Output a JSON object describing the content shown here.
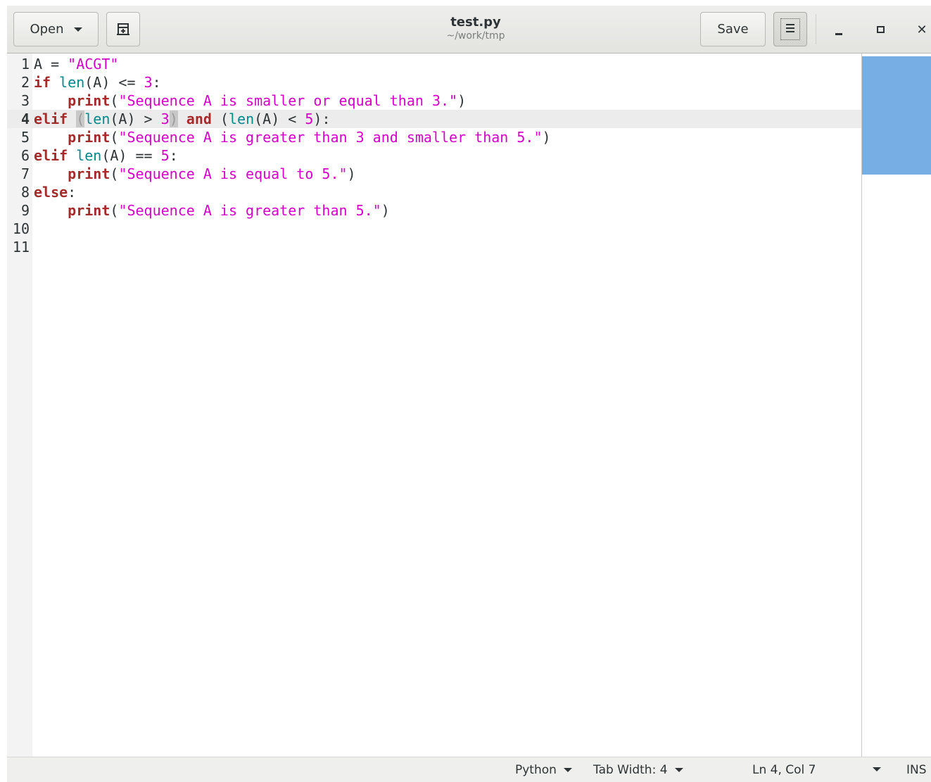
{
  "header": {
    "open_label": "Open",
    "save_label": "Save",
    "title": "test.py",
    "subtitle": "~/work/tmp"
  },
  "editor": {
    "current_line": 4,
    "lines": [
      {
        "n": "1",
        "tokens": [
          {
            "t": "A = "
          },
          {
            "t": "\"ACGT\"",
            "c": "str"
          }
        ]
      },
      {
        "n": "2",
        "tokens": [
          {
            "t": "if",
            "c": "kw"
          },
          {
            "t": " "
          },
          {
            "t": "len",
            "c": "bi"
          },
          {
            "t": "(A) <= "
          },
          {
            "t": "3",
            "c": "num"
          },
          {
            "t": ":"
          }
        ]
      },
      {
        "n": "3",
        "tokens": [
          {
            "t": "    "
          },
          {
            "t": "print",
            "c": "kw"
          },
          {
            "t": "("
          },
          {
            "t": "\"Sequence A is smaller or equal than 3.\"",
            "c": "str"
          },
          {
            "t": ")"
          }
        ]
      },
      {
        "n": "4",
        "tokens": [
          {
            "t": "elif",
            "c": "kw"
          },
          {
            "t": " "
          },
          {
            "t": "(",
            "c": "bm"
          },
          {
            "t": "len",
            "c": "bi"
          },
          {
            "t": "(A) > "
          },
          {
            "t": "3",
            "c": "num"
          },
          {
            "t": ")",
            "c": "bm"
          },
          {
            "t": " "
          },
          {
            "t": "and",
            "c": "kw"
          },
          {
            "t": " ("
          },
          {
            "t": "len",
            "c": "bi"
          },
          {
            "t": "(A) < "
          },
          {
            "t": "5",
            "c": "num"
          },
          {
            "t": "):"
          }
        ]
      },
      {
        "n": "5",
        "tokens": [
          {
            "t": "    "
          },
          {
            "t": "print",
            "c": "kw"
          },
          {
            "t": "("
          },
          {
            "t": "\"Sequence A is greater than 3 and smaller than 5.\"",
            "c": "str"
          },
          {
            "t": ")"
          }
        ]
      },
      {
        "n": "6",
        "tokens": [
          {
            "t": "elif",
            "c": "kw"
          },
          {
            "t": " "
          },
          {
            "t": "len",
            "c": "bi"
          },
          {
            "t": "(A) == "
          },
          {
            "t": "5",
            "c": "num"
          },
          {
            "t": ":"
          }
        ]
      },
      {
        "n": "7",
        "tokens": [
          {
            "t": "    "
          },
          {
            "t": "print",
            "c": "kw"
          },
          {
            "t": "("
          },
          {
            "t": "\"Sequence A is equal to 5.\"",
            "c": "str"
          },
          {
            "t": ")"
          }
        ]
      },
      {
        "n": "8",
        "tokens": [
          {
            "t": "else",
            "c": "kw"
          },
          {
            "t": ":"
          }
        ]
      },
      {
        "n": "9",
        "tokens": [
          {
            "t": "    "
          },
          {
            "t": "print",
            "c": "kw"
          },
          {
            "t": "("
          },
          {
            "t": "\"Sequence A is greater than 5.\"",
            "c": "str"
          },
          {
            "t": ")"
          }
        ]
      },
      {
        "n": "10",
        "tokens": []
      },
      {
        "n": "11",
        "tokens": []
      }
    ]
  },
  "statusbar": {
    "language": "Python",
    "tab_width": "Tab Width: 4",
    "position": "Ln 4, Col 7",
    "mode": "INS"
  },
  "colors": {
    "keyword": "#a52a2a",
    "builtin": "#008a8c",
    "string": "#d400c8",
    "minimap_slider": "#77aee3"
  }
}
